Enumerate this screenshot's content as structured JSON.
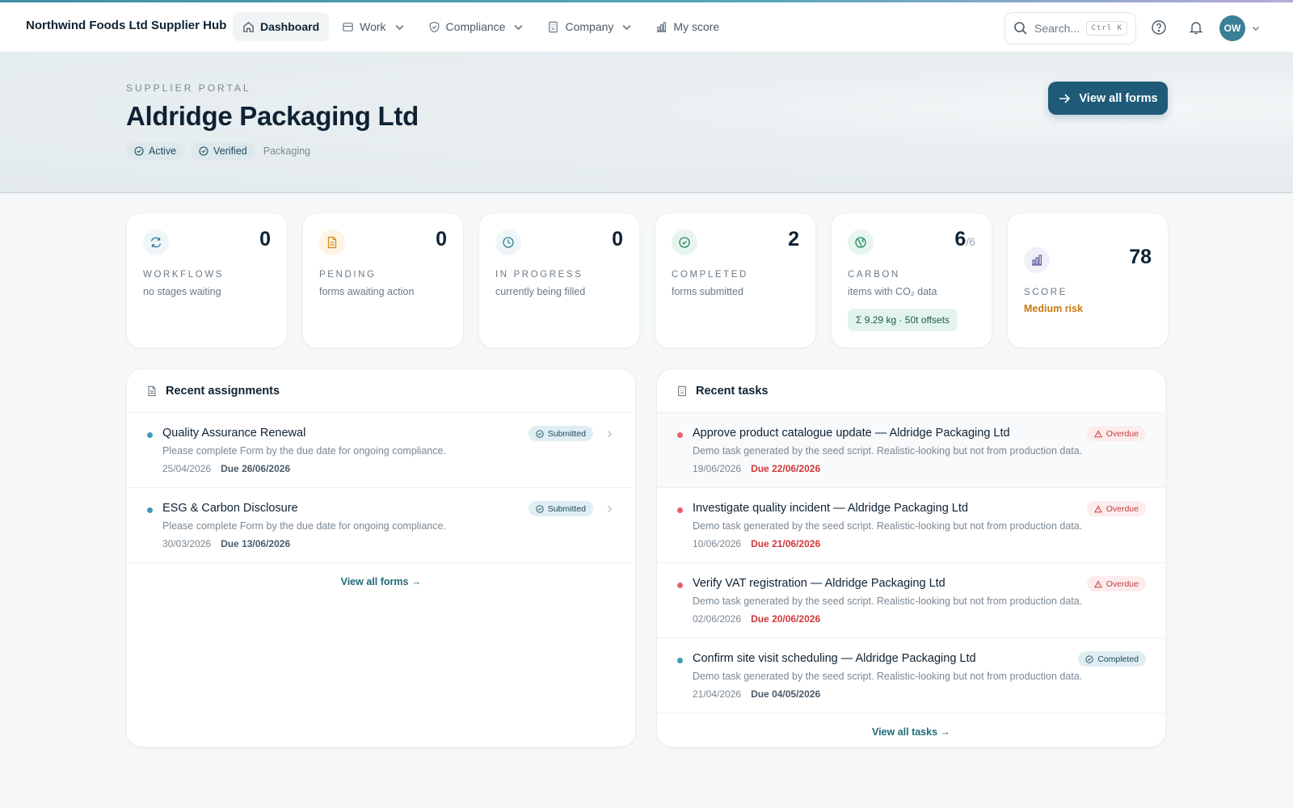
{
  "app": {
    "brand": "Northwind Foods Ltd Supplier Hub"
  },
  "nav": {
    "dashboard": "Dashboard",
    "work": "Work",
    "compliance": "Compliance",
    "company": "Company",
    "my_score": "My score"
  },
  "search": {
    "placeholder": "Search...",
    "shortcut": "Ctrl K"
  },
  "user": {
    "initials": "OW"
  },
  "hero": {
    "eyebrow": "SUPPLIER PORTAL",
    "title": "Aldridge Packaging Ltd",
    "badges": [
      "Active",
      "Verified"
    ],
    "category": "Packaging",
    "cta": "View all forms"
  },
  "stats": [
    {
      "label": "WORKFLOWS",
      "value": "0",
      "sub": "no stages waiting",
      "icon": "refresh-icon"
    },
    {
      "label": "PENDING",
      "value": "0",
      "sub": "forms awaiting action",
      "icon": "document-icon"
    },
    {
      "label": "IN PROGRESS",
      "value": "0",
      "sub": "currently being filled",
      "icon": "clock-icon"
    },
    {
      "label": "COMPLETED",
      "value": "2",
      "sub": "forms submitted",
      "icon": "check-circle-icon"
    },
    {
      "label": "CARBON",
      "value": "6",
      "value_total": "/6",
      "sub": "items with CO₂ data",
      "pill": "Σ 9.29 kg · 50t offsets",
      "icon": "globe-icon"
    },
    {
      "label": "SCORE",
      "value": "78",
      "sub": "Medium risk",
      "icon": "bar-chart-icon"
    }
  ],
  "assignments": {
    "title": "Recent assignments",
    "items": [
      {
        "title": "Quality Assurance Renewal",
        "desc": "Please complete Form by the due date for ongoing compliance.",
        "date": "25/04/2026",
        "due": "Due 26/06/2026",
        "status": "Submitted"
      },
      {
        "title": "ESG & Carbon Disclosure",
        "desc": "Please complete Form by the due date for ongoing compliance.",
        "date": "30/03/2026",
        "due": "Due 13/06/2026",
        "status": "Submitted"
      }
    ],
    "footer": "View all forms →"
  },
  "tasks": {
    "title": "Recent tasks",
    "items": [
      {
        "title": "Approve product catalogue update — Aldridge Packaging Ltd",
        "desc": "Demo task generated by the seed script. Realistic-looking but not from production data.",
        "date": "19/06/2026",
        "due": "Due 22/06/2026",
        "status": "Overdue"
      },
      {
        "title": "Investigate quality incident — Aldridge Packaging Ltd",
        "desc": "Demo task generated by the seed script. Realistic-looking but not from production data.",
        "date": "10/06/2026",
        "due": "Due 21/06/2026",
        "status": "Overdue"
      },
      {
        "title": "Verify VAT registration — Aldridge Packaging Ltd",
        "desc": "Demo task generated by the seed script. Realistic-looking but not from production data.",
        "date": "02/06/2026",
        "due": "Due 20/06/2026",
        "status": "Overdue"
      },
      {
        "title": "Confirm site visit scheduling — Aldridge Packaging Ltd",
        "desc": "Demo task generated by the seed script. Realistic-looking but not from production data.",
        "date": "21/04/2026",
        "due": "Due 04/05/2026",
        "status": "Completed"
      }
    ],
    "footer": "View all tasks →"
  },
  "colors": {
    "primary": "#1f5a78",
    "overdue": "#d2383b",
    "risk_medium": "#c97a10",
    "dot_blue": "#3f9ab8",
    "dot_red": "#e8606a"
  }
}
